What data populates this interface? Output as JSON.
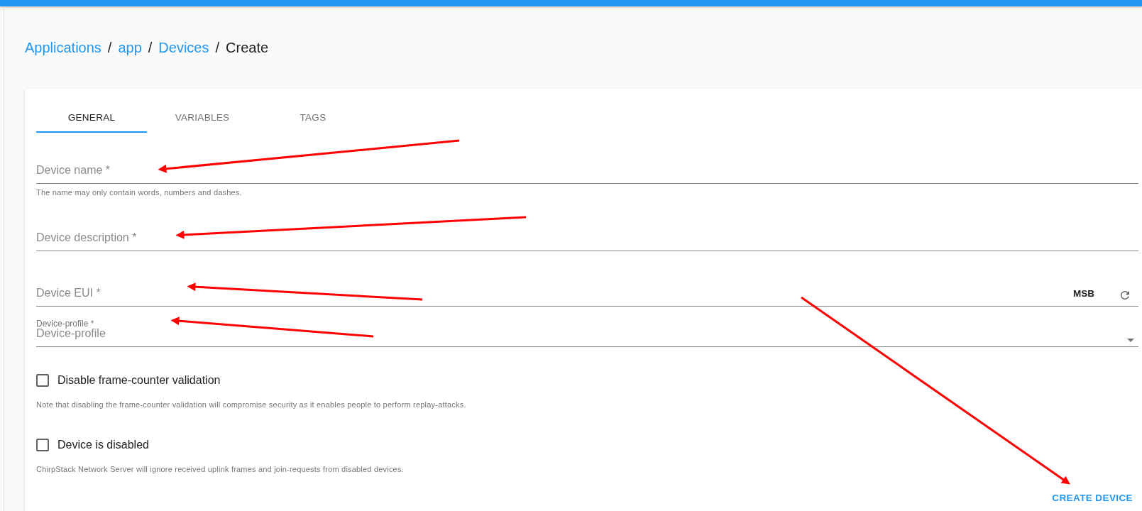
{
  "breadcrumb": [
    {
      "kind": "link",
      "label": "Applications"
    },
    {
      "kind": "separator",
      "label": "/"
    },
    {
      "kind": "link",
      "label": "app"
    },
    {
      "kind": "separator",
      "label": "/"
    },
    {
      "kind": "link",
      "label": "Devices"
    },
    {
      "kind": "separator",
      "label": "/"
    },
    {
      "kind": "current",
      "label": "Create"
    }
  ],
  "tabs": [
    {
      "label": "GENERAL",
      "selected": true
    },
    {
      "label": "VARIABLES",
      "selected": false
    },
    {
      "label": "TAGS",
      "selected": false
    }
  ],
  "fields": [
    {
      "kind": "text",
      "placeholder": "Device name *",
      "helper": "The name may only contain words, numbers and dashes."
    },
    {
      "kind": "text",
      "placeholder": "Device description *"
    },
    {
      "kind": "eui",
      "placeholder": "Device EUI *",
      "byte_order": "MSB"
    },
    {
      "kind": "select",
      "label": "Device-profile *",
      "placeholder": "Device-profile"
    }
  ],
  "checkboxes": [
    {
      "label": "Disable frame-counter validation",
      "checked": false,
      "helper": "Note that disabling the frame-counter validation will compromise security as it enables people to perform replay-attacks."
    },
    {
      "label": "Device is disabled",
      "checked": false,
      "helper": "ChirpStack Network Server will ignore received uplink frames and join-requests from disabled devices."
    }
  ],
  "submit": "CREATE DEVICE"
}
